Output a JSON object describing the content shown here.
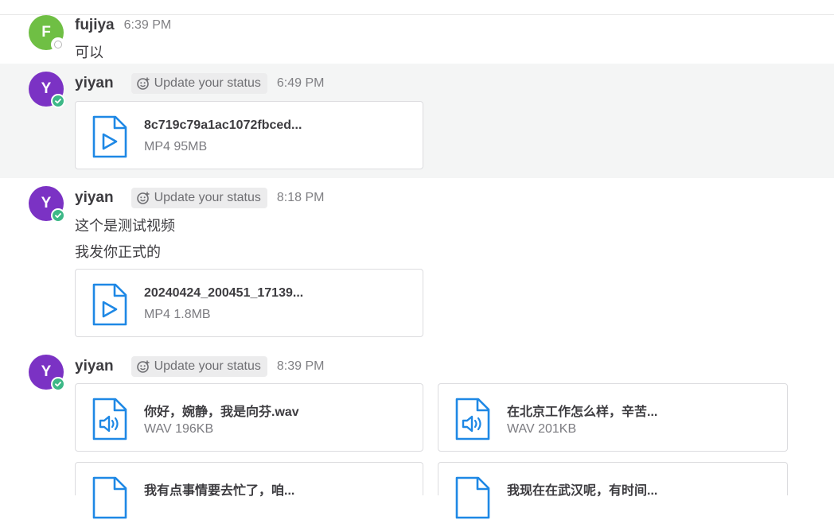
{
  "colors": {
    "accent": "#1c58d9",
    "icon_blue": "#1e88e5",
    "online": "#3db887",
    "avatar_f": "#6fbf44",
    "avatar_y": "#7b32c4"
  },
  "messages": [
    {
      "user": "fujiya",
      "initial": "F",
      "time": "6:39 PM",
      "text": "可以"
    },
    {
      "user": "yiyan",
      "initial": "Y",
      "status": "Update your status",
      "time": "6:49 PM",
      "files": [
        {
          "name": "8c719c79a1ac1072fbced...",
          "meta": "MP4 95MB",
          "icon": "video-file-icon"
        }
      ]
    },
    {
      "user": "yiyan",
      "initial": "Y",
      "status": "Update your status",
      "time": "8:18 PM",
      "lines": [
        "这个是测试视频",
        "我发你正式的"
      ],
      "files": [
        {
          "name": "20240424_200451_17139...",
          "meta": "MP4 1.8MB",
          "icon": "video-file-icon"
        }
      ]
    },
    {
      "user": "yiyan",
      "initial": "Y",
      "status": "Update your status",
      "time": "8:39 PM",
      "files": [
        {
          "name": "你好，婉静，我是向芬.wav",
          "meta": "WAV 196KB",
          "icon": "audio-file-icon"
        },
        {
          "name": "在北京工作怎么样，辛苦...",
          "meta": "WAV 201KB",
          "icon": "audio-file-icon"
        },
        {
          "name": "我有点事情要去忙了，咱...",
          "icon": "audio-file-icon"
        },
        {
          "name": "我现在在武汉呢，有时间...",
          "icon": "audio-file-icon"
        }
      ]
    }
  ]
}
